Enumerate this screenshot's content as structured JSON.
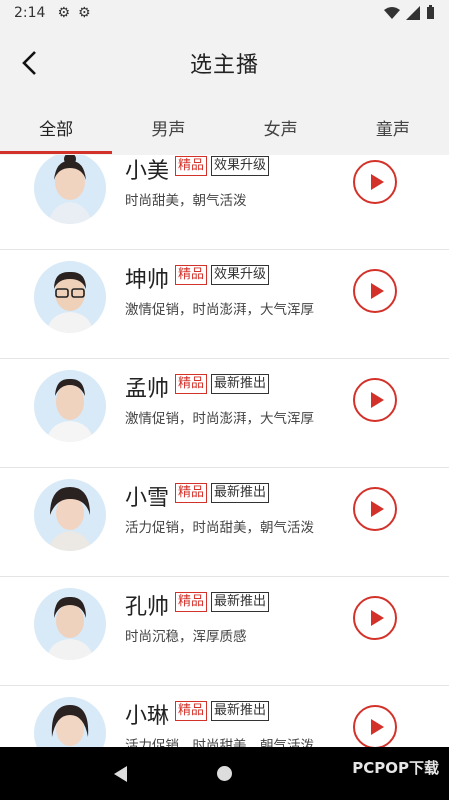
{
  "status": {
    "time": "2:14"
  },
  "header": {
    "title": "选主播"
  },
  "tabs": [
    {
      "label": "全部",
      "active": true
    },
    {
      "label": "男声",
      "active": false
    },
    {
      "label": "女声",
      "active": false
    },
    {
      "label": "童声",
      "active": false
    }
  ],
  "voices": [
    {
      "name": "小美",
      "premium": "精品",
      "tag": "效果升级",
      "desc": "时尚甜美，朝气活泼"
    },
    {
      "name": "坤帅",
      "premium": "精品",
      "tag": "效果升级",
      "desc": "激情促销，时尚澎湃，大气浑厚"
    },
    {
      "name": "孟帅",
      "premium": "精品",
      "tag": "最新推出",
      "desc": "激情促销，时尚澎湃，大气浑厚"
    },
    {
      "name": "小雪",
      "premium": "精品",
      "tag": "最新推出",
      "desc": "活力促销，时尚甜美，朝气活泼"
    },
    {
      "name": "孔帅",
      "premium": "精品",
      "tag": "最新推出",
      "desc": "时尚沉稳，浑厚质感"
    },
    {
      "name": "小琳",
      "premium": "精品",
      "tag": "最新推出",
      "desc": "活力促销，时尚甜美，朝气活泼"
    }
  ],
  "watermark": "PCPOP下载",
  "colors": {
    "accent": "#d3322a"
  }
}
